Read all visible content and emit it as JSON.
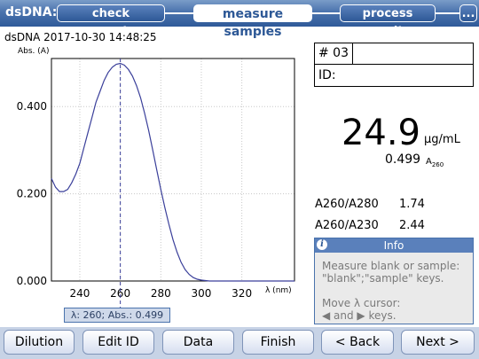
{
  "header": {
    "app_label": "dsDNA:",
    "tabs": [
      {
        "label": "check parameters",
        "active": false
      },
      {
        "label": "measure samples",
        "active": true
      },
      {
        "label": "process results",
        "active": false
      },
      {
        "label": "...",
        "active": false
      }
    ]
  },
  "sample": {
    "title": "dsDNA 2017-10-30 14:48:25",
    "number": "# 03",
    "id_label": "ID:"
  },
  "chart_data": {
    "type": "line",
    "ylabel": "Abs. (A)",
    "xlabel": "λ (nm)",
    "xlim": [
      226,
      346
    ],
    "ylim": [
      0,
      0.5
    ],
    "x_ticks": [
      "240",
      "260",
      "280",
      "300",
      "320"
    ],
    "y_ticks": [
      "0.000",
      "0.200",
      "0.400"
    ],
    "grid": true,
    "cursor_x": 260,
    "series": [
      {
        "x": [
          226,
          228,
          230,
          232,
          234,
          236,
          238,
          240,
          242,
          244,
          246,
          248,
          250,
          252,
          254,
          256,
          258,
          260,
          262,
          264,
          266,
          268,
          270,
          272,
          274,
          276,
          278,
          280,
          282,
          284,
          286,
          288,
          290,
          292,
          294,
          296,
          298,
          300,
          302,
          304,
          306,
          308,
          310,
          312,
          314,
          320,
          330,
          346
        ],
        "y": [
          0.235,
          0.215,
          0.205,
          0.205,
          0.21,
          0.225,
          0.245,
          0.27,
          0.305,
          0.34,
          0.375,
          0.41,
          0.435,
          0.46,
          0.478,
          0.49,
          0.497,
          0.499,
          0.495,
          0.485,
          0.47,
          0.448,
          0.42,
          0.385,
          0.345,
          0.3,
          0.255,
          0.21,
          0.168,
          0.13,
          0.095,
          0.066,
          0.043,
          0.026,
          0.015,
          0.008,
          0.004,
          0.002,
          0.001,
          0.0,
          0.0,
          0.0,
          0.0,
          0.0,
          0.0,
          0.0,
          0.0,
          0.0
        ]
      }
    ],
    "line_color": "#3a3f9a"
  },
  "cursor": {
    "readout": "λ: 260; Abs.: 0.499"
  },
  "result": {
    "concentration": "24.9",
    "unit": "µg/mL",
    "absorbance": "0.499",
    "abs_unit": "A",
    "abs_unit_sub": "260"
  },
  "ratios": [
    {
      "label": "A260/A280",
      "value": "1.74"
    },
    {
      "label": "A260/A230",
      "value": "2.44"
    }
  ],
  "info": {
    "title": "Info",
    "icon": "info-icon",
    "line1": "Measure blank or sample:",
    "line2": "\"blank\";\"sample\" keys.",
    "line3": "Move λ cursor:",
    "line4": "◀ and ▶ keys."
  },
  "buttons": {
    "dilution": "Dilution",
    "edit_id": "Edit ID",
    "data": "Data",
    "finish": "Finish",
    "back": "< Back",
    "next": "Next >"
  }
}
